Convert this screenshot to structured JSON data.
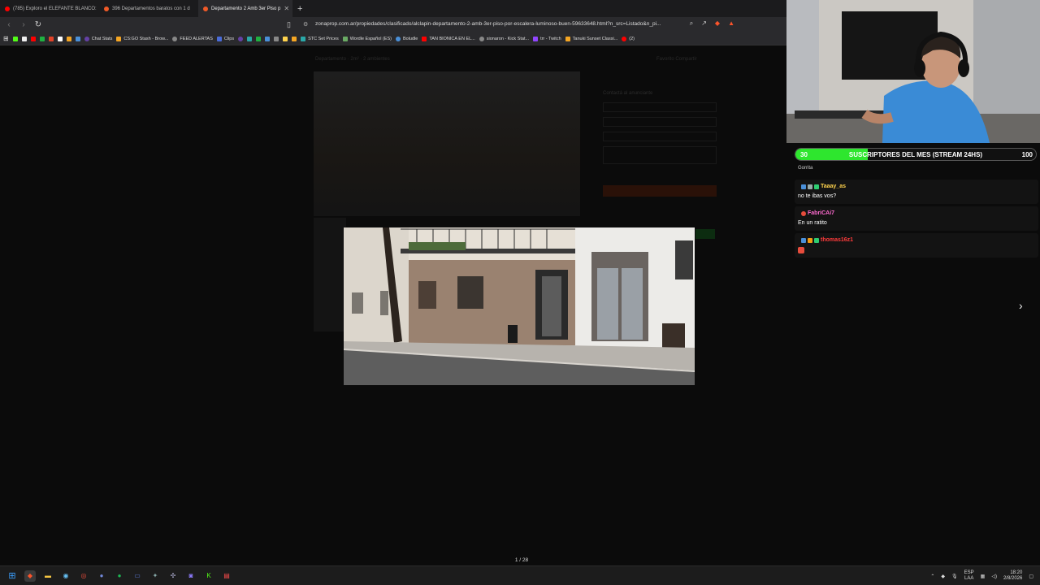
{
  "browser": {
    "tabs": [
      {
        "label": "(785) Exploro el ELEFANTE BLANCO:",
        "color": "#ff0000",
        "active": false
      },
      {
        "label": "396 Departamentos baratos con 1 d",
        "color": "#f05a28",
        "active": false
      },
      {
        "label": "Departamento 2 Amb 3er Piso p",
        "color": "#f05a28",
        "active": true
      }
    ],
    "new_tab": "+",
    "url": "zonaprop.com.ar/propiedades/clasificado/alclapin-departamento-2-amb-3er-piso-por-escalera-luminoso-buen-59633648.html?n_src=Listado&n_pi...",
    "bookmarks": [
      "Chat Stats",
      "CS:GO Stash - Brow...",
      "FEED ALERTAS",
      "Clips",
      "STC Set Prices",
      "Wordle Español (ES)",
      "Boludle",
      "TAN BIONICA EN EL...",
      "sionaron - Kick Stat...",
      "trr - Twitch",
      "Tanuki Sunset Classi...",
      "(2)"
    ]
  },
  "page": {
    "breadcrumb": "Departamento · 2m² · 2 ambientes",
    "right_links": "Favorito   Compartir",
    "contact_title": "Contactá al anunciante"
  },
  "lightbox": {
    "counter": "1 / 28",
    "next_icon": "›"
  },
  "stream": {
    "goal": {
      "start": "30",
      "label": "SUSCRIPTORES DEL MES (STREAM 24HS)",
      "end": "100",
      "progress": 0.3,
      "color": "#2ee62e"
    },
    "chat_cut": "Gorrita",
    "messages": [
      {
        "user": "Taaay_as",
        "color": "#ffd34d",
        "text": "no te ibas vos?"
      },
      {
        "user": "FabriCAi7",
        "color": "#ff6bd0",
        "text": "En un ratito"
      },
      {
        "user": "thomas16z1",
        "color": "#ff3b3b",
        "text": ""
      }
    ]
  },
  "taskbar": {
    "lang_top": "ESP",
    "lang_bottom": "LAA",
    "time": "18:20",
    "date": "2/8/2026"
  }
}
